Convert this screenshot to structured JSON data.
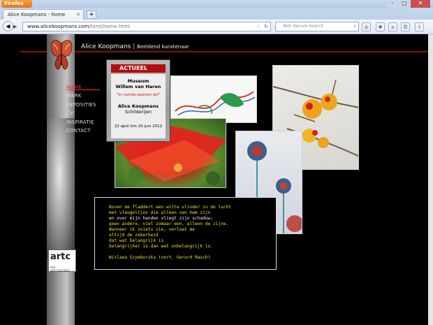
{
  "browser": {
    "app_button": "Firefox",
    "tab_title": "Alice Koopmans - home",
    "url_host": "www.alicekoopmans.com",
    "url_path": "/html/home.html",
    "search_placeholder": "AVG Secure Search"
  },
  "site": {
    "name": "Alice Koopmans",
    "separator": "|",
    "subtitle": "Beeldend kunstenaar"
  },
  "menu": {
    "items": [
      "HOME",
      "WERK",
      "EXPOSITIES",
      "CV",
      "INSPIRATIE",
      "CONTACT"
    ],
    "active": "HOME"
  },
  "poster": {
    "header": "ACTUEEL",
    "line1": "Museum",
    "line2": "Willem van Haren",
    "line3": "\"In ruimte zweven wij\"",
    "line4": "Alice Koopmans",
    "line5": "Schilderijen",
    "line6": "22 april t/m 10 juni 2012"
  },
  "poem": {
    "lines": [
      "Boven me fladdert een witte vlinder in de lucht",
      "met vleugeltjes die alleen van hem zijn",
      "en over mijn handen vliegt zijn schaduw;",
      "geen andere, niet zomaar een, alleen de zijne.",
      "Wanneer ik zoiets zie, verlaat me",
      "altijd de zekerheid",
      "dat wat belangrijk is",
      "belangrijker is dan wat onbelangrijk is."
    ],
    "author": "Wislawa Szymborska",
    "translator": "(vert. Gerard Rasch)"
  },
  "logo": {
    "text": "artc",
    "tagline": "AIA ARTCENTERS"
  },
  "colors": {
    "accent_red": "#8a0f12",
    "menu_active": "#ff2a2a",
    "poem_text": "#e8e31e"
  }
}
